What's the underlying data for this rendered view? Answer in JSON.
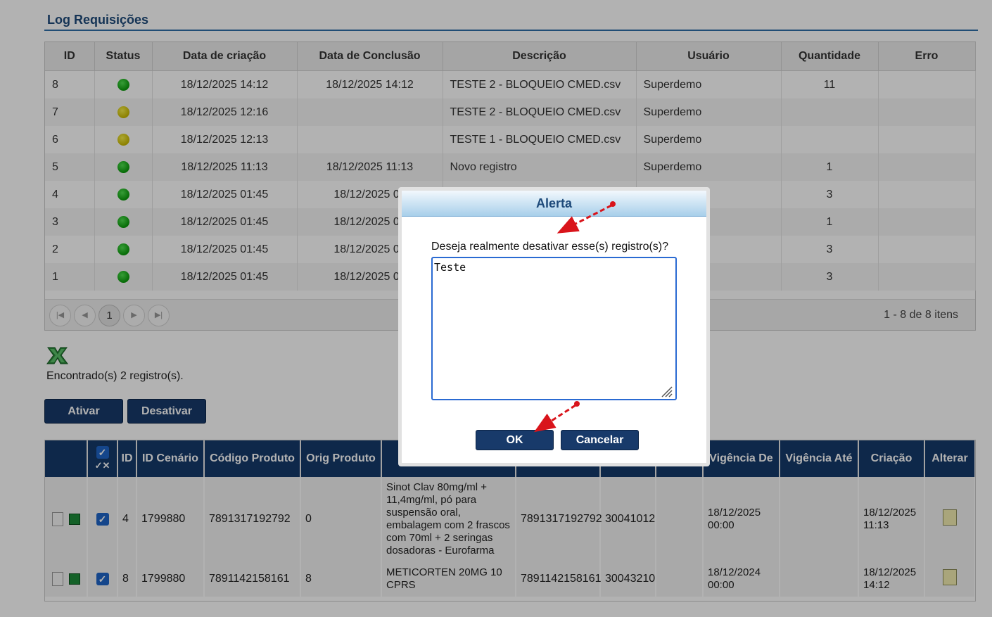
{
  "log": {
    "title": "Log Requisições",
    "columns": [
      "ID",
      "Status",
      "Data de criação",
      "Data de Conclusão",
      "Descrição",
      "Usuário",
      "Quantidade",
      "Erro"
    ],
    "rows": [
      {
        "id": "8",
        "status": "green",
        "created": "18/12/2025 14:12",
        "concluded": "18/12/2025 14:12",
        "description": "TESTE 2 - BLOQUEIO CMED.csv",
        "user": "Superdemo",
        "quantity": "11",
        "error": ""
      },
      {
        "id": "7",
        "status": "yellow",
        "created": "18/12/2025 12:16",
        "concluded": "",
        "description": "TESTE 2 - BLOQUEIO CMED.csv",
        "user": "Superdemo",
        "quantity": "",
        "error": ""
      },
      {
        "id": "6",
        "status": "yellow",
        "created": "18/12/2025 12:13",
        "concluded": "",
        "description": "TESTE 1 - BLOQUEIO CMED.csv",
        "user": "Superdemo",
        "quantity": "",
        "error": ""
      },
      {
        "id": "5",
        "status": "green",
        "created": "18/12/2025 11:13",
        "concluded": "18/12/2025 11:13",
        "description": "Novo registro",
        "user": "Superdemo",
        "quantity": "1",
        "error": ""
      },
      {
        "id": "4",
        "status": "green",
        "created": "18/12/2025 01:45",
        "concluded": "18/12/2025 01",
        "description": "",
        "user": "",
        "quantity": "3",
        "error": ""
      },
      {
        "id": "3",
        "status": "green",
        "created": "18/12/2025 01:45",
        "concluded": "18/12/2025 01",
        "description": "",
        "user": "",
        "quantity": "1",
        "error": ""
      },
      {
        "id": "2",
        "status": "green",
        "created": "18/12/2025 01:45",
        "concluded": "18/12/2025 01",
        "description": "",
        "user": "",
        "quantity": "3",
        "error": ""
      },
      {
        "id": "1",
        "status": "green",
        "created": "18/12/2025 01:45",
        "concluded": "18/12/2025 01",
        "description": "",
        "user": "",
        "quantity": "3",
        "error": ""
      }
    ],
    "pager": {
      "current_page": "1",
      "info": "1 - 8 de 8 itens"
    }
  },
  "found_text": "Encontrado(s) 2 registro(s).",
  "actions": {
    "activate": "Ativar",
    "deactivate": "Desativar"
  },
  "grid": {
    "columns": [
      "",
      "",
      "ID",
      "ID Cenário",
      "Código Produto",
      "Orig Produto",
      "",
      "",
      "",
      "",
      "Vigência De",
      "Vigência Até",
      "Criação",
      "Alterar"
    ],
    "select_all_sub": "✓✕",
    "rows": [
      {
        "id": "4",
        "scenario": "1799880",
        "product_code": "7891317192792",
        "orig": "0",
        "description": "Sinot Clav 80mg/ml + 11,4mg/ml, pó para suspensão oral, embalagem com 2 frascos com 70ml + 2 seringas dosadoras - Eurofarma",
        "ean": "7891317192792",
        "ncm": "30041012",
        "extra": "",
        "valid_from": "18/12/2025 00:00",
        "valid_to": "",
        "created": "18/12/2025 11:13"
      },
      {
        "id": "8",
        "scenario": "1799880",
        "product_code": "7891142158161",
        "orig": "8",
        "description": "METICORTEN 20MG 10 CPRS",
        "ean": "7891142158161",
        "ncm": "30043210",
        "extra": "",
        "valid_from": "18/12/2024 00:00",
        "valid_to": "",
        "created": "18/12/2025 14:12"
      }
    ]
  },
  "dialog": {
    "title": "Alerta",
    "message": "Deseja realmente desativar esse(s) registro(s)?",
    "textarea_value": "Teste",
    "ok": "OK",
    "cancel": "Cancelar"
  },
  "colors": {
    "header_dark": "#153a6b",
    "accent": "#1e4a7a",
    "status_green": "#0a9a0a",
    "status_yellow": "#c8b800",
    "arrow": "#d9141b"
  }
}
